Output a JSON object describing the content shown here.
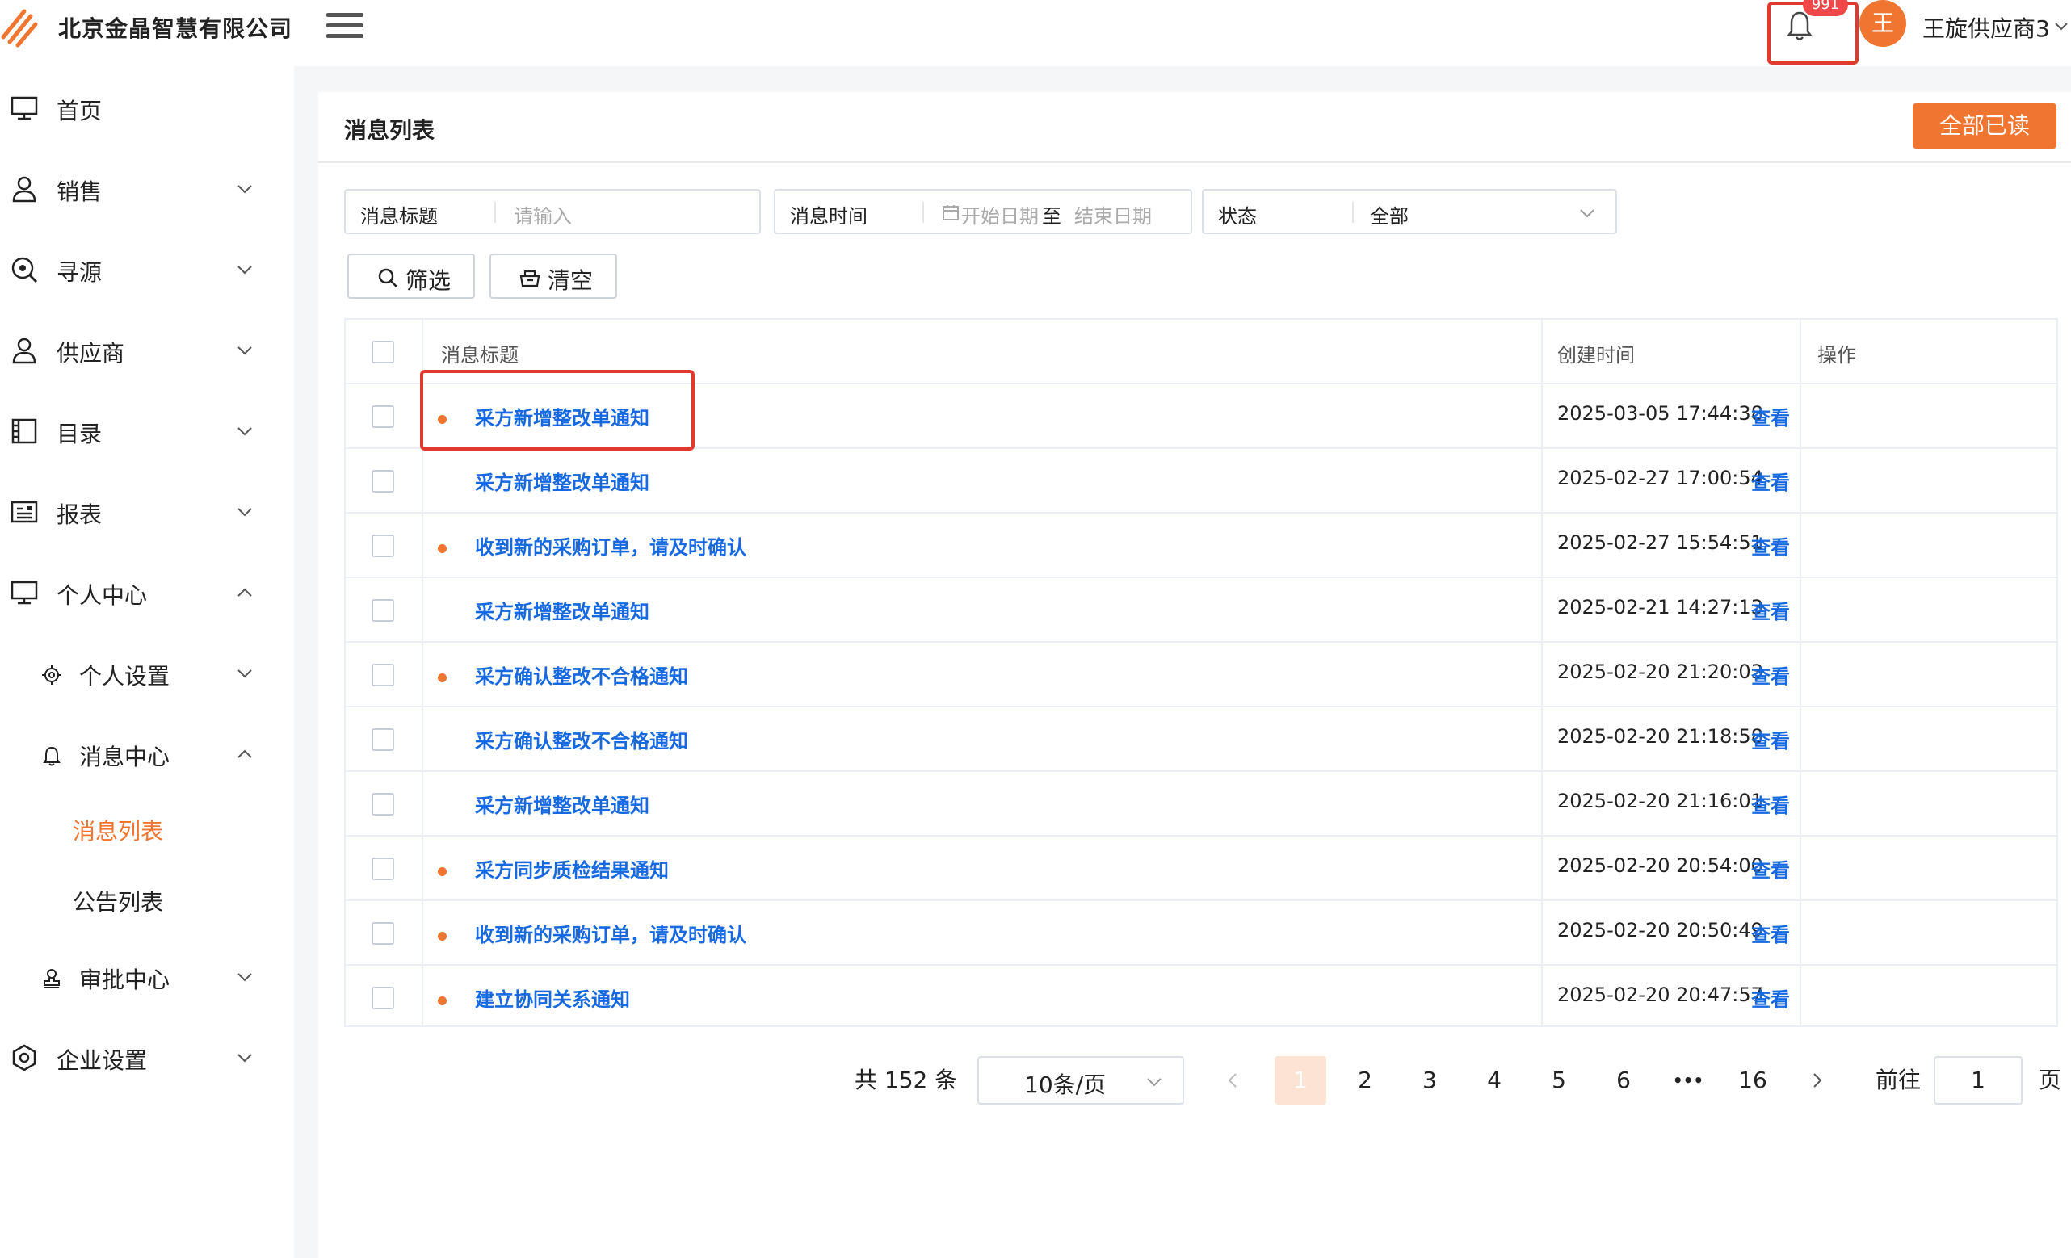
{
  "header": {
    "company": "北京金晶智慧有限公司",
    "badge": "991",
    "avatar_letter": "王",
    "username": "王旋供应商3"
  },
  "sidebar": {
    "items": [
      {
        "label": "首页",
        "icon": "monitor-icon"
      },
      {
        "label": "销售",
        "icon": "person-icon"
      },
      {
        "label": "寻源",
        "icon": "search-circle-icon"
      },
      {
        "label": "供应商",
        "icon": "person-icon"
      },
      {
        "label": "目录",
        "icon": "book-icon"
      },
      {
        "label": "报表",
        "icon": "report-icon"
      },
      {
        "label": "个人中心",
        "icon": "monitor-icon"
      },
      {
        "label": "个人设置",
        "icon": "gear-icon"
      },
      {
        "label": "消息中心",
        "icon": "bell-icon"
      },
      {
        "label": "消息列表"
      },
      {
        "label": "公告列表"
      },
      {
        "label": "审批中心",
        "icon": "stamp-icon"
      },
      {
        "label": "企业设置",
        "icon": "settings-hex-icon"
      }
    ]
  },
  "main": {
    "title": "消息列表",
    "read_all": "全部已读",
    "filters": {
      "title_label": "消息标题",
      "title_placeholder": "请输入",
      "time_label": "消息时间",
      "start_placeholder": "开始日期",
      "range_sep": "至",
      "end_placeholder": "结束日期",
      "status_label": "状态",
      "status_value": "全部"
    },
    "buttons": {
      "filter": "筛选",
      "clear": "清空"
    },
    "table": {
      "columns": [
        "消息标题",
        "创建时间",
        "操作"
      ],
      "rows": [
        {
          "unread": true,
          "title": "采方新增整改单通知",
          "time": "2025-03-05 17:44:38",
          "action": "查看"
        },
        {
          "unread": false,
          "title": "采方新增整改单通知",
          "time": "2025-02-27 17:00:54",
          "action": "查看"
        },
        {
          "unread": true,
          "title": "收到新的采购订单，请及时确认",
          "time": "2025-02-27 15:54:51",
          "action": "查看"
        },
        {
          "unread": false,
          "title": "采方新增整改单通知",
          "time": "2025-02-21 14:27:13",
          "action": "查看"
        },
        {
          "unread": true,
          "title": "采方确认整改不合格通知",
          "time": "2025-02-20 21:20:03",
          "action": "查看"
        },
        {
          "unread": false,
          "title": "采方确认整改不合格通知",
          "time": "2025-02-20 21:18:58",
          "action": "查看"
        },
        {
          "unread": false,
          "title": "采方新增整改单通知",
          "time": "2025-02-20 21:16:01",
          "action": "查看"
        },
        {
          "unread": true,
          "title": "采方同步质检结果通知",
          "time": "2025-02-20 20:54:00",
          "action": "查看"
        },
        {
          "unread": true,
          "title": "收到新的采购订单，请及时确认",
          "time": "2025-02-20 20:50:49",
          "action": "查看"
        },
        {
          "unread": true,
          "title": "建立协同关系通知",
          "time": "2025-02-20 20:47:57",
          "action": "查看"
        }
      ]
    },
    "pagination": {
      "total": "共 152 条",
      "page_size": "10条/页",
      "pages": [
        "1",
        "2",
        "3",
        "4",
        "5",
        "6",
        "•••",
        "16"
      ],
      "current": "1",
      "goto_label": "前往",
      "goto_value": "1",
      "goto_unit": "页"
    }
  },
  "colors": {
    "accent": "#f07530",
    "link": "#1769e0",
    "highlight": "#e03a2e"
  }
}
